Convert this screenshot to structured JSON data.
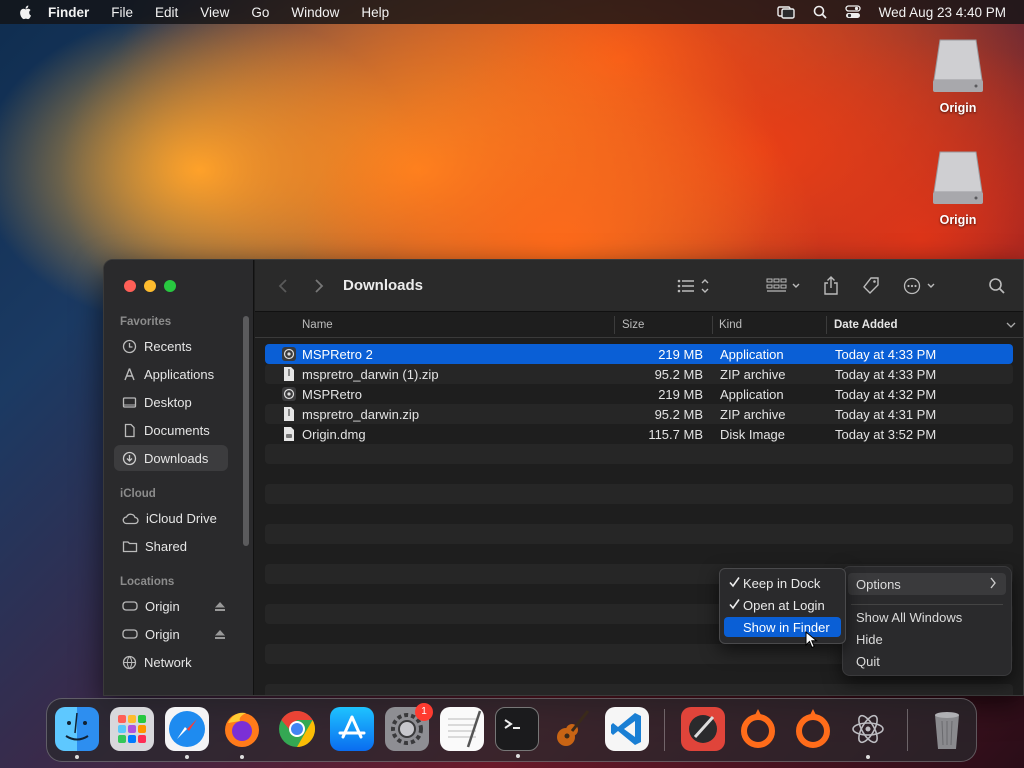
{
  "menubar": {
    "app_name": "Finder",
    "items": [
      "File",
      "Edit",
      "View",
      "Go",
      "Window",
      "Help"
    ],
    "datetime": "Wed Aug 23  4:40 PM"
  },
  "desktop": {
    "icons": [
      {
        "label": "Origin"
      },
      {
        "label": "Origin"
      }
    ]
  },
  "finder": {
    "title": "Downloads",
    "sidebar": {
      "favorites_label": "Favorites",
      "favorites": [
        "Recents",
        "Applications",
        "Desktop",
        "Documents",
        "Downloads"
      ],
      "icloud_label": "iCloud",
      "icloud": [
        "iCloud Drive",
        "Shared"
      ],
      "locations_label": "Locations",
      "locations": [
        "Origin",
        "Origin",
        "Network"
      ]
    },
    "columns": {
      "name": "Name",
      "size": "Size",
      "kind": "Kind",
      "date": "Date Added"
    },
    "files": [
      {
        "name": "MSPRetro 2",
        "size": "219 MB",
        "kind": "Application",
        "date": "Today at 4:33 PM"
      },
      {
        "name": "mspretro_darwin (1).zip",
        "size": "95.2 MB",
        "kind": "ZIP archive",
        "date": "Today at 4:33 PM"
      },
      {
        "name": "MSPRetro",
        "size": "219 MB",
        "kind": "Application",
        "date": "Today at 4:32 PM"
      },
      {
        "name": "mspretro_darwin.zip",
        "size": "95.2 MB",
        "kind": "ZIP archive",
        "date": "Today at 4:31 PM"
      },
      {
        "name": "Origin.dmg",
        "size": "115.7 MB",
        "kind": "Disk Image",
        "date": "Today at 3:52 PM"
      }
    ]
  },
  "options_submenu": {
    "keep_in_dock": "Keep in Dock",
    "open_at_login": "Open at Login",
    "show_in_finder": "Show in Finder"
  },
  "dock_menu": {
    "options": "Options",
    "show_all_windows": "Show All Windows",
    "hide": "Hide",
    "quit": "Quit"
  },
  "dock": {
    "settings_badge": "1",
    "apps": [
      "Finder",
      "Launchpad",
      "Safari",
      "Firefox",
      "Chrome",
      "App Store",
      "System Settings",
      "TextEdit",
      "Terminal",
      "GarageBand",
      "Visual Studio Code",
      "Script Editor",
      "Origin",
      "Origin",
      "MSPRetro",
      "Trash"
    ]
  },
  "colors": {
    "selection": "#0a5fd6",
    "close": "#ff5f57",
    "minimize": "#febc2e",
    "zoom": "#28c840"
  }
}
